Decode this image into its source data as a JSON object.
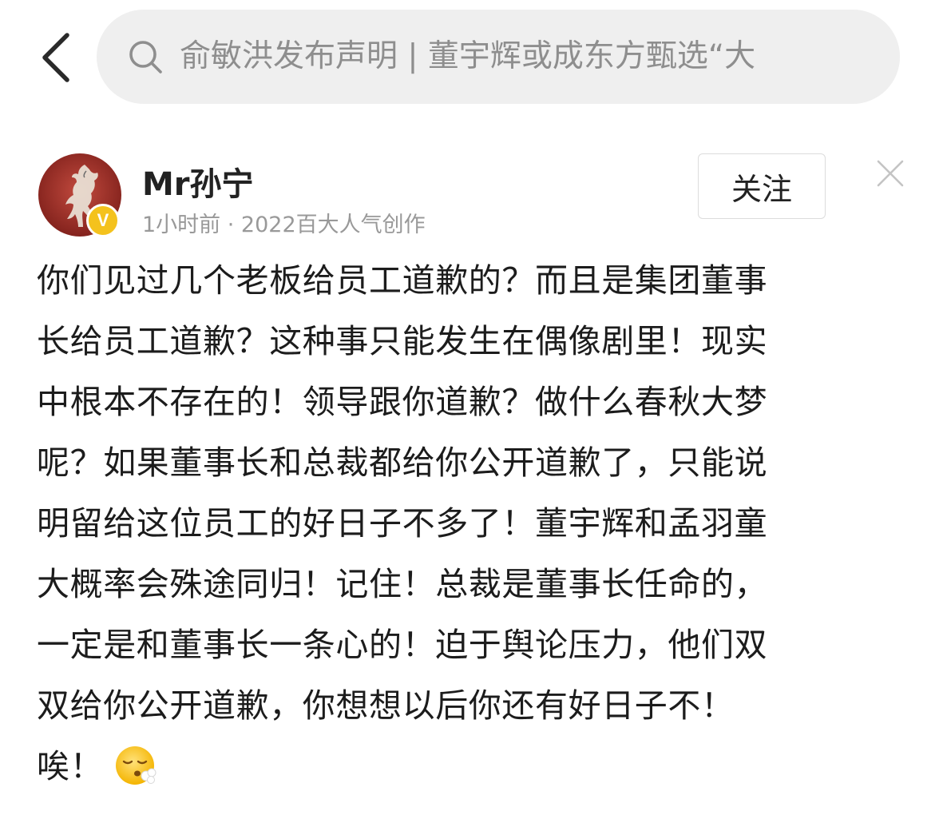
{
  "header": {
    "back_icon": "chevron-left-icon",
    "search": {
      "icon": "search-icon",
      "text": "俞敏洪发布声明 | 董宇辉或成东方甄选“大"
    }
  },
  "post": {
    "author": {
      "name": "Mr孙宁",
      "avatar_icon": "horse-avatar",
      "badge_label": "V"
    },
    "meta": "1小时前 · 2022百大人气创作",
    "follow_label": "关注",
    "close_icon": "close-icon",
    "lines": [
      "你们见过几个老板给员工道歉的？而且是集团董事",
      "长给员工道歉？这种事只能发生在偶像剧里！现实",
      "中根本不存在的！领导跟你道歉？做什么春秋大梦",
      "呢？如果董事长和总裁都给你公开道歉了，只能说",
      "明留给这位员工的好日子不多了！董宇辉和孟羽童",
      "大概率会殊途同归！记住！总裁是董事长任命的，",
      "一定是和董事长一条心的！迫于舆论压力，他们双",
      "双给你公开道歉，你想想以后你还有好日子不！",
      "唉！"
    ],
    "emoji_icon": "exhaling-face-emoji"
  },
  "colors": {
    "search_bg": "#efefef",
    "text_primary": "#1c1c1c",
    "text_secondary": "#999999",
    "badge": "#f4c21d",
    "avatar_bg": "#a8342c"
  }
}
